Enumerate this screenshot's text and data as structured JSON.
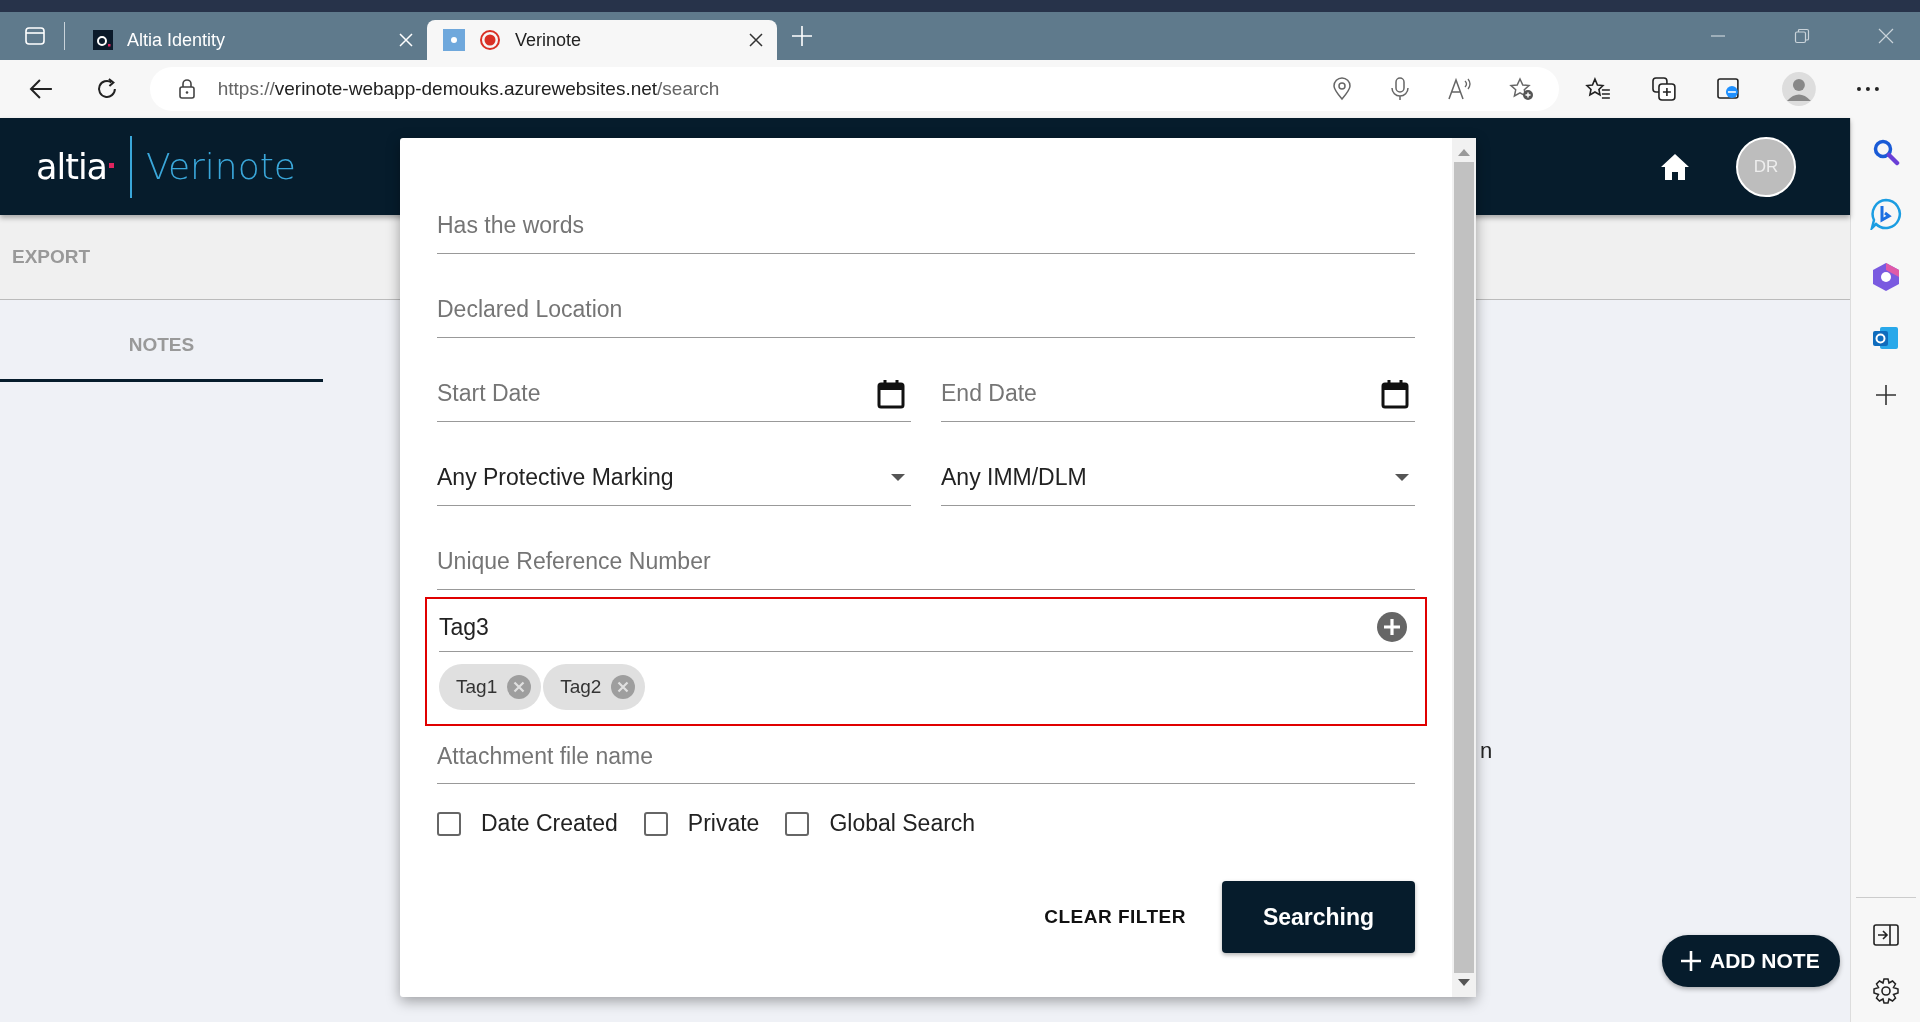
{
  "browser": {
    "tabs": [
      {
        "title": "Altia Identity",
        "selected": false
      },
      {
        "title": "Verinote",
        "selected": true
      }
    ],
    "url": {
      "scheme": "https://",
      "host": "verinote-webapp-demouks.azurewebsites.net",
      "path": "/search"
    }
  },
  "app": {
    "logo": {
      "brand": "altia",
      "product": "Verinote"
    },
    "avatar": "DR",
    "toolbar_action": "EXPORT",
    "tabs": [
      {
        "label": "NOTES",
        "selected": true
      }
    ],
    "background_fragment": "n",
    "fab": "ADD NOTE"
  },
  "dialog": {
    "rows": [
      [
        {
          "kind": "text",
          "placeholder": "Has the words"
        }
      ],
      [
        {
          "kind": "text",
          "placeholder": "Declared Location"
        }
      ],
      [
        {
          "kind": "date",
          "placeholder": "Start Date"
        },
        {
          "kind": "date",
          "placeholder": "End Date"
        }
      ],
      [
        {
          "kind": "select",
          "value": "Any Protective Marking"
        },
        {
          "kind": "select",
          "value": "Any IMM/DLM"
        }
      ],
      [
        {
          "kind": "text",
          "placeholder": "Unique Reference Number"
        }
      ]
    ],
    "tags": {
      "highlighted": true,
      "value": "Tag3",
      "chips": [
        "Tag1",
        "Tag2"
      ]
    },
    "attachment": {
      "placeholder": "Attachment file name"
    },
    "checkboxes": [
      {
        "label": "Date Created",
        "checked": false
      },
      {
        "label": "Private",
        "checked": false
      },
      {
        "label": "Global Search",
        "checked": false
      }
    ],
    "clear_button": "CLEAR FILTER",
    "search_button": "Searching"
  }
}
